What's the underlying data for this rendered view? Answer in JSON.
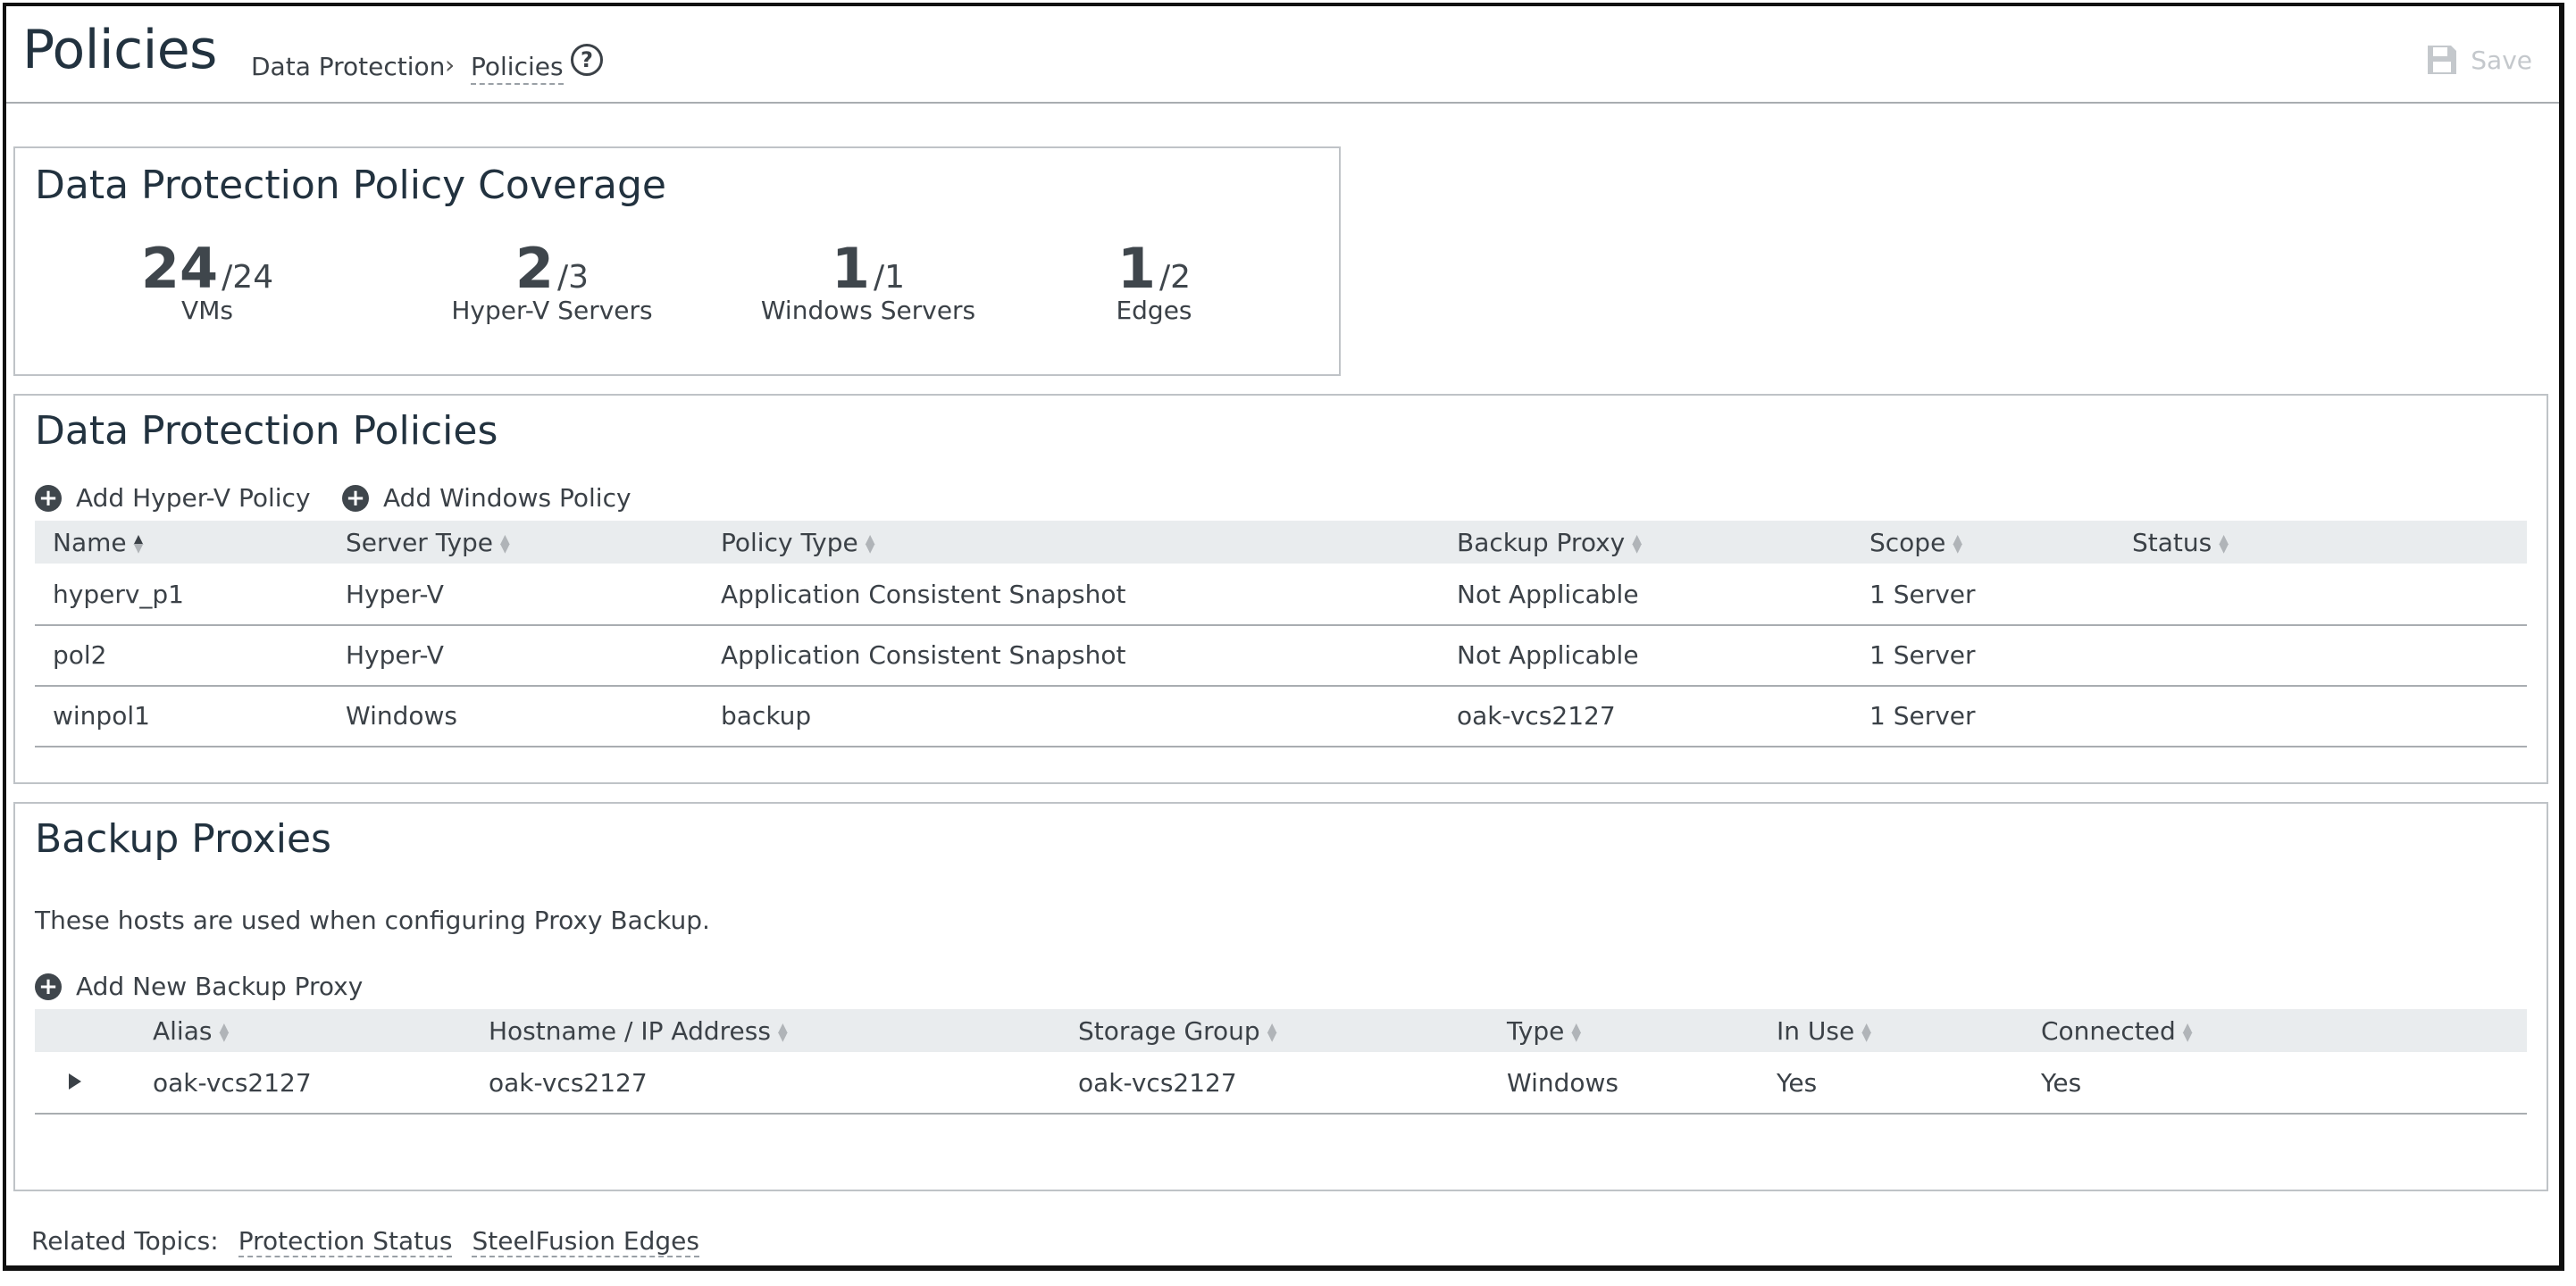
{
  "header": {
    "title": "Policies",
    "breadcrumb": [
      "Data Protection",
      "Policies"
    ],
    "breadcrumb_separator": "›",
    "help_symbol": "?",
    "save_label": "Save",
    "save_icon": "floppy-disk-icon"
  },
  "coverage": {
    "title": "Data Protection Policy Coverage",
    "stats": [
      {
        "value": "24",
        "total": "/24",
        "label": "VMs"
      },
      {
        "value": "2",
        "total": "/3",
        "label": "Hyper-V Servers"
      },
      {
        "value": "1",
        "total": "/1",
        "label": "Windows Servers"
      },
      {
        "value": "1",
        "total": "/2",
        "label": "Edges"
      }
    ]
  },
  "policies": {
    "title": "Data Protection Policies",
    "add_hyperv": "Add Hyper-V Policy",
    "add_windows": "Add Windows Policy",
    "columns": [
      "Name",
      "Server Type",
      "Policy Type",
      "Backup Proxy",
      "Scope",
      "Status"
    ],
    "rows": [
      [
        "hyperv_p1",
        "Hyper-V",
        "Application Consistent Snapshot",
        "Not Applicable",
        "1 Server",
        ""
      ],
      [
        "pol2",
        "Hyper-V",
        "Application Consistent Snapshot",
        "Not Applicable",
        "1 Server",
        ""
      ],
      [
        "winpol1",
        "Windows",
        "backup",
        "oak-vcs2127",
        "1 Server",
        ""
      ]
    ]
  },
  "proxies": {
    "title": "Backup Proxies",
    "description": "These hosts are used when configuring Proxy Backup.",
    "add_label": "Add New Backup Proxy",
    "columns": [
      "Alias",
      "Hostname / IP Address",
      "Storage Group",
      "Type",
      "In Use",
      "Connected"
    ],
    "rows": [
      [
        "oak-vcs2127",
        "oak-vcs2127",
        "oak-vcs2127",
        "Windows",
        "Yes",
        "Yes"
      ]
    ]
  },
  "related": {
    "label": "Related Topics:",
    "links": [
      "Protection Status",
      "SteelFusion Edges"
    ]
  }
}
